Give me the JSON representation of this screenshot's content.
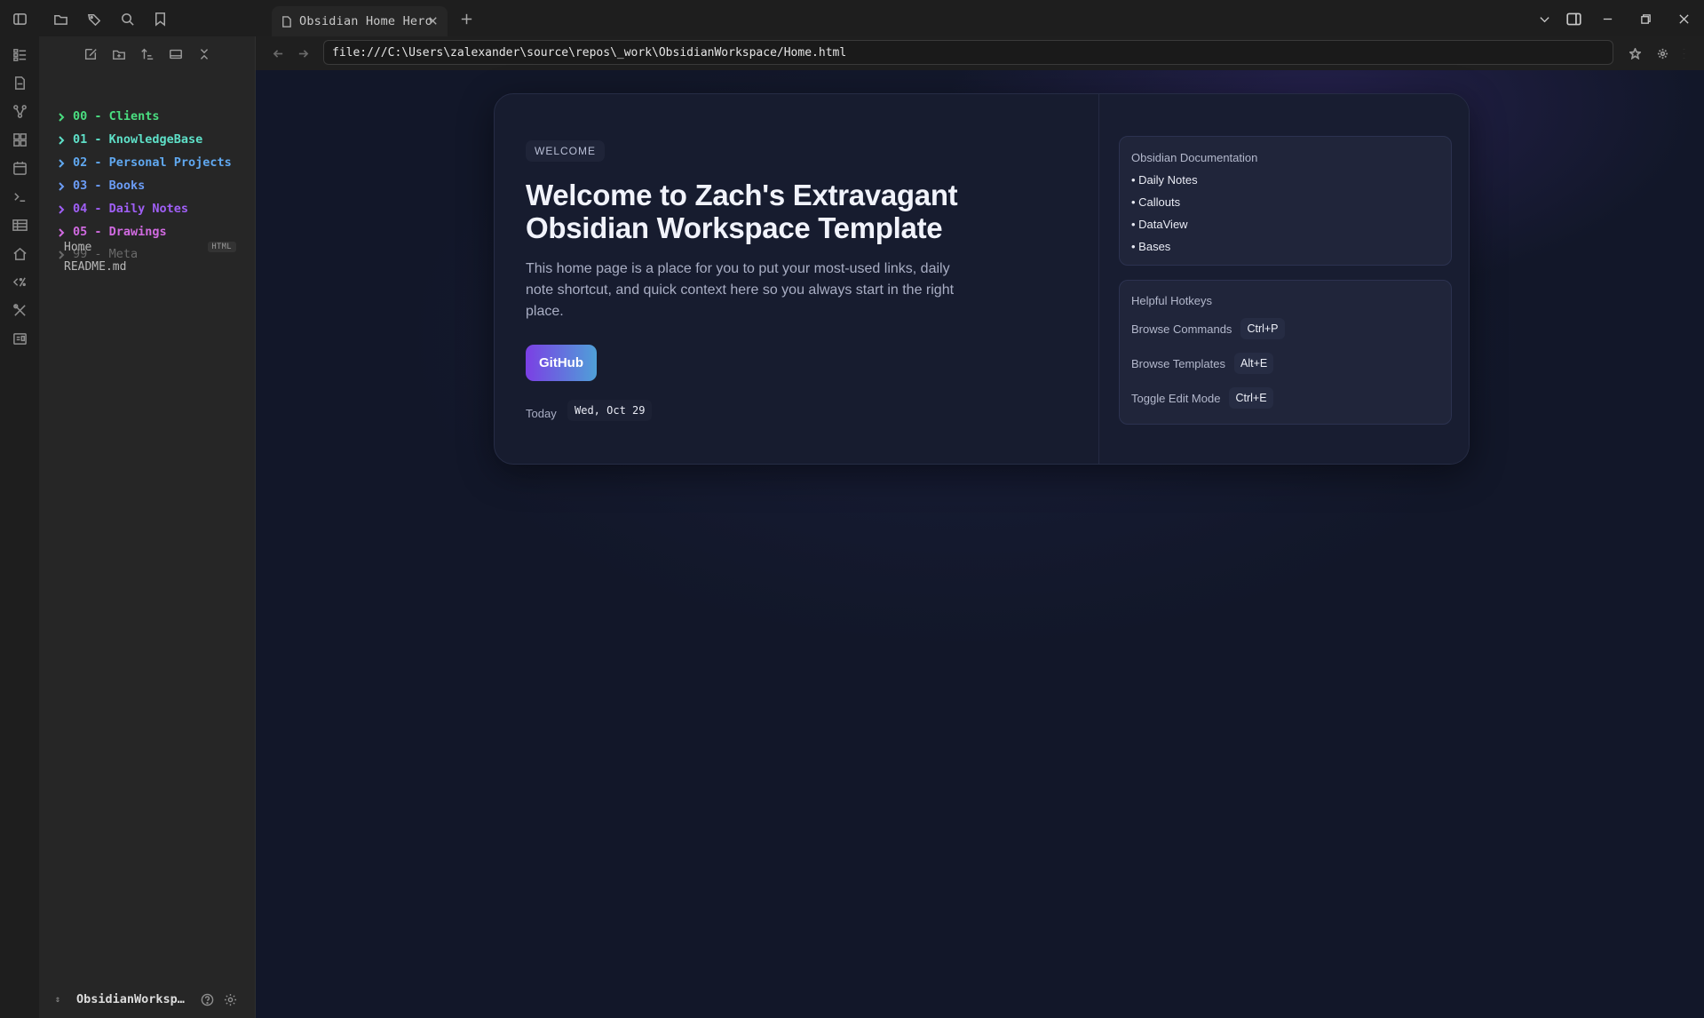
{
  "titlebar": {
    "tab_title": "Obsidian Home Hero",
    "icons": [
      "sidebar-toggle-icon",
      "folder-icon",
      "tags-icon",
      "search-icon",
      "bookmark-icon",
      "close-icon",
      "plus-icon",
      "chevron-down-icon",
      "right-sidebar-icon",
      "minimize-icon",
      "restore-icon",
      "window-close-icon"
    ]
  },
  "ribbon": {
    "icons": [
      "dashboard-icon",
      "open-file-icon",
      "graph-icon",
      "canvas-icon",
      "calendar-icon",
      "terminal-icon",
      "table-icon",
      "home-icon",
      "templater-icon",
      "tools-icon",
      "journal-icon"
    ]
  },
  "sidebar": {
    "toolbar_icons": [
      "new-note-icon",
      "new-folder-icon",
      "sort-icon",
      "collapse-view-icon",
      "collapse-all-icon"
    ],
    "folders": [
      {
        "label": "00 - Clients",
        "color": "#4ade80"
      },
      {
        "label": "01 - KnowledgeBase",
        "color": "#5ee0c8"
      },
      {
        "label": "02 - Personal Projects",
        "color": "#60a8f0"
      },
      {
        "label": "03 - Books",
        "color": "#6b9cf5"
      },
      {
        "label": "04 - Daily Notes",
        "color": "#9f5ff5"
      },
      {
        "label": "05 - Drawings",
        "color": "#d06ae0"
      },
      {
        "label": "99 - Meta",
        "color": "#6a6a6a"
      }
    ],
    "files": [
      {
        "label": "Home",
        "badge": "HTML"
      },
      {
        "label": "README.md",
        "badge": ""
      }
    ],
    "vault_name": "ObsidianWorksp…"
  },
  "browser": {
    "url": "file:///C:\\Users\\zalexander\\source\\repos\\_work\\ObsidianWorkspace/Home.html"
  },
  "hero": {
    "pill": "WELCOME",
    "title": "Welcome to Zach's Extravagant Obsidian Workspace Template",
    "lead": "This home page is a place for you to put your most-used links, daily note shortcut, and quick context here so you always start in the right place.",
    "button": "GitHub",
    "today_label": "Today",
    "today_value": "Wed, Oct 29"
  },
  "docs_card": {
    "title": "Obsidian Documentation",
    "links": [
      "• Daily Notes",
      "• Callouts",
      "• DataView",
      "• Bases"
    ]
  },
  "hotkeys_card": {
    "title": "Helpful Hotkeys",
    "rows": [
      {
        "label": "Browse Commands",
        "key": "Ctrl+P"
      },
      {
        "label": "Browse Templates",
        "key": "Alt+E"
      },
      {
        "label": "Toggle Edit Mode",
        "key": "Ctrl+E"
      }
    ]
  }
}
